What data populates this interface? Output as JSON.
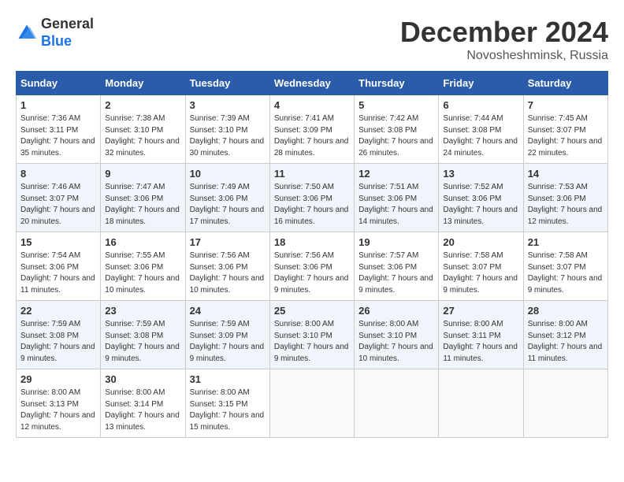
{
  "logo": {
    "general": "General",
    "blue": "Blue"
  },
  "title": "December 2024",
  "location": "Novosheshminsk, Russia",
  "days_header": [
    "Sunday",
    "Monday",
    "Tuesday",
    "Wednesday",
    "Thursday",
    "Friday",
    "Saturday"
  ],
  "weeks": [
    [
      {
        "day": "1",
        "sunrise": "7:36 AM",
        "sunset": "3:11 PM",
        "daylight": "7 hours and 35 minutes."
      },
      {
        "day": "2",
        "sunrise": "7:38 AM",
        "sunset": "3:10 PM",
        "daylight": "7 hours and 32 minutes."
      },
      {
        "day": "3",
        "sunrise": "7:39 AM",
        "sunset": "3:10 PM",
        "daylight": "7 hours and 30 minutes."
      },
      {
        "day": "4",
        "sunrise": "7:41 AM",
        "sunset": "3:09 PM",
        "daylight": "7 hours and 28 minutes."
      },
      {
        "day": "5",
        "sunrise": "7:42 AM",
        "sunset": "3:08 PM",
        "daylight": "7 hours and 26 minutes."
      },
      {
        "day": "6",
        "sunrise": "7:44 AM",
        "sunset": "3:08 PM",
        "daylight": "7 hours and 24 minutes."
      },
      {
        "day": "7",
        "sunrise": "7:45 AM",
        "sunset": "3:07 PM",
        "daylight": "7 hours and 22 minutes."
      }
    ],
    [
      {
        "day": "8",
        "sunrise": "7:46 AM",
        "sunset": "3:07 PM",
        "daylight": "7 hours and 20 minutes."
      },
      {
        "day": "9",
        "sunrise": "7:47 AM",
        "sunset": "3:06 PM",
        "daylight": "7 hours and 18 minutes."
      },
      {
        "day": "10",
        "sunrise": "7:49 AM",
        "sunset": "3:06 PM",
        "daylight": "7 hours and 17 minutes."
      },
      {
        "day": "11",
        "sunrise": "7:50 AM",
        "sunset": "3:06 PM",
        "daylight": "7 hours and 16 minutes."
      },
      {
        "day": "12",
        "sunrise": "7:51 AM",
        "sunset": "3:06 PM",
        "daylight": "7 hours and 14 minutes."
      },
      {
        "day": "13",
        "sunrise": "7:52 AM",
        "sunset": "3:06 PM",
        "daylight": "7 hours and 13 minutes."
      },
      {
        "day": "14",
        "sunrise": "7:53 AM",
        "sunset": "3:06 PM",
        "daylight": "7 hours and 12 minutes."
      }
    ],
    [
      {
        "day": "15",
        "sunrise": "7:54 AM",
        "sunset": "3:06 PM",
        "daylight": "7 hours and 11 minutes."
      },
      {
        "day": "16",
        "sunrise": "7:55 AM",
        "sunset": "3:06 PM",
        "daylight": "7 hours and 10 minutes."
      },
      {
        "day": "17",
        "sunrise": "7:56 AM",
        "sunset": "3:06 PM",
        "daylight": "7 hours and 10 minutes."
      },
      {
        "day": "18",
        "sunrise": "7:56 AM",
        "sunset": "3:06 PM",
        "daylight": "7 hours and 9 minutes."
      },
      {
        "day": "19",
        "sunrise": "7:57 AM",
        "sunset": "3:06 PM",
        "daylight": "7 hours and 9 minutes."
      },
      {
        "day": "20",
        "sunrise": "7:58 AM",
        "sunset": "3:07 PM",
        "daylight": "7 hours and 9 minutes."
      },
      {
        "day": "21",
        "sunrise": "7:58 AM",
        "sunset": "3:07 PM",
        "daylight": "7 hours and 9 minutes."
      }
    ],
    [
      {
        "day": "22",
        "sunrise": "7:59 AM",
        "sunset": "3:08 PM",
        "daylight": "7 hours and 9 minutes."
      },
      {
        "day": "23",
        "sunrise": "7:59 AM",
        "sunset": "3:08 PM",
        "daylight": "7 hours and 9 minutes."
      },
      {
        "day": "24",
        "sunrise": "7:59 AM",
        "sunset": "3:09 PM",
        "daylight": "7 hours and 9 minutes."
      },
      {
        "day": "25",
        "sunrise": "8:00 AM",
        "sunset": "3:10 PM",
        "daylight": "7 hours and 9 minutes."
      },
      {
        "day": "26",
        "sunrise": "8:00 AM",
        "sunset": "3:10 PM",
        "daylight": "7 hours and 10 minutes."
      },
      {
        "day": "27",
        "sunrise": "8:00 AM",
        "sunset": "3:11 PM",
        "daylight": "7 hours and 11 minutes."
      },
      {
        "day": "28",
        "sunrise": "8:00 AM",
        "sunset": "3:12 PM",
        "daylight": "7 hours and 11 minutes."
      }
    ],
    [
      {
        "day": "29",
        "sunrise": "8:00 AM",
        "sunset": "3:13 PM",
        "daylight": "7 hours and 12 minutes."
      },
      {
        "day": "30",
        "sunrise": "8:00 AM",
        "sunset": "3:14 PM",
        "daylight": "7 hours and 13 minutes."
      },
      {
        "day": "31",
        "sunrise": "8:00 AM",
        "sunset": "3:15 PM",
        "daylight": "7 hours and 15 minutes."
      },
      null,
      null,
      null,
      null
    ]
  ],
  "labels": {
    "sunrise": "Sunrise: ",
    "sunset": "Sunset: ",
    "daylight": "Daylight: "
  }
}
